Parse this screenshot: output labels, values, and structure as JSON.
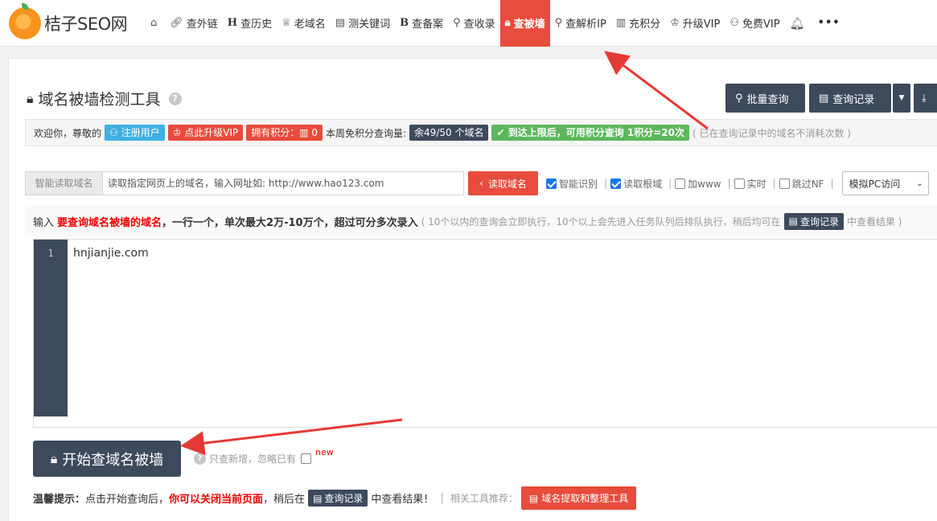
{
  "nav": {
    "logo_text": "桔子SEO网",
    "items": [
      {
        "label": "",
        "icon": "home-icon"
      },
      {
        "label": "查外链",
        "icon": "link-icon"
      },
      {
        "label": "查历史",
        "icon": "history-h-icon"
      },
      {
        "label": "老域名",
        "icon": "trophy-icon"
      },
      {
        "label": "测关键词",
        "icon": "document-icon"
      },
      {
        "label": "查备案",
        "icon": "beian-b-icon"
      },
      {
        "label": "查收录",
        "icon": "search-icon"
      },
      {
        "label": "查被墙",
        "icon": "lock-icon"
      },
      {
        "label": "查解析IP",
        "icon": "location-icon"
      },
      {
        "label": "充积分",
        "icon": "chart-icon"
      },
      {
        "label": "升级VIP",
        "icon": "crown-icon"
      },
      {
        "label": "免费VIP",
        "icon": "user-add-icon"
      }
    ],
    "bell_icon": "bell-icon",
    "more_icon": "more-icon"
  },
  "page": {
    "title": "域名被墙检测工具",
    "help_glyph": "?",
    "toolbar": {
      "batch": "批量查询",
      "history": "查询记录"
    }
  },
  "welcome": {
    "greeting": "欢迎你，尊敬的",
    "user_badge": "注册用户",
    "upgrade_badge": "点此升级VIP",
    "points_badge": "拥有积分：",
    "points_value": "0",
    "quota_label": "本周免积分查询量:",
    "quota_badge": "余49/50 个域名",
    "limit_badge": "到达上限后，可用积分查询 1积分=20次",
    "note": "( 已在查询记录中的域名不消耗次数 )"
  },
  "fetch": {
    "label": "智能读取域名",
    "input_value": "读取指定网页上的域名，输入网址如: http://www.hao123.com",
    "button": "读取域名",
    "options": [
      {
        "label": "智能识别",
        "checked": true
      },
      {
        "label": "读取根域",
        "checked": true
      },
      {
        "label": "加www",
        "checked": false
      },
      {
        "label": "实时",
        "checked": false
      },
      {
        "label": "跳过NF",
        "checked": false
      }
    ],
    "select_value": "模拟PC访问"
  },
  "input_hint": {
    "prefix": "输入",
    "red": "要查询域名被墙的域名",
    "rest": "，一行一个，单次最大2万-10万个，超过可分多次录入",
    "muted": "( 10个以内的查询会立即执行，10个以上会先进入任务队列后排队执行，稍后均可在",
    "btn": "查询记录",
    "tail": "中查看结果 )"
  },
  "editor": {
    "line_no": "1",
    "content": "hnjianjie.com"
  },
  "start": {
    "button": "开始查域名被墙",
    "help_glyph": "?",
    "only_new": "只查新增，忽略已有",
    "new_tag": "new"
  },
  "tips": {
    "label": "温馨提示：",
    "text1": "点击开始查询后，",
    "red": "你可以关闭当前页面",
    "text2": "，稍后在",
    "btn": "查询记录",
    "text3": "中查看结果！",
    "sep": "|",
    "related": "相关工具推荐：",
    "tool": "域名提取和整理工具"
  },
  "colors": {
    "accent_red": "#e74c3c",
    "dark": "#3d4a5c",
    "green": "#5cb85c",
    "blue": "#3fb0e3"
  }
}
